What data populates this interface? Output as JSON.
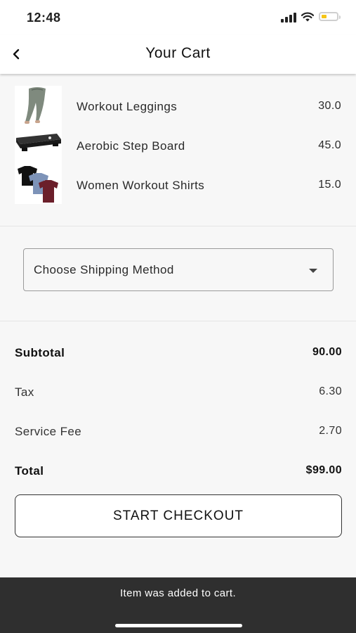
{
  "status_bar": {
    "time": "12:48"
  },
  "nav": {
    "title": "Your Cart",
    "back_icon": "chevron-left-icon"
  },
  "cart_items": [
    {
      "name": "Workout Leggings",
      "price": "30.0",
      "thumb": "leggings-image"
    },
    {
      "name": "Aerobic Step Board",
      "price": "45.0",
      "thumb": "step-board-image"
    },
    {
      "name": "Women Workout Shirts",
      "price": "15.0",
      "thumb": "shirts-image"
    }
  ],
  "shipping": {
    "placeholder": "Choose Shipping Method",
    "icon": "caret-down-icon"
  },
  "summary": {
    "subtotal_label": "Subtotal",
    "subtotal_value": "90.00",
    "tax_label": "Tax",
    "tax_value": "6.30",
    "fee_label": "Service Fee",
    "fee_value": "2.70",
    "total_label": "Total",
    "total_value": "$99.00"
  },
  "checkout": {
    "label": "START CHECKOUT"
  },
  "toast": {
    "message": "Item was added to cart."
  },
  "colors": {
    "toast_bg": "#2f2f2f",
    "battery": "#f5c518",
    "page_bg": "#f7f7f7"
  }
}
